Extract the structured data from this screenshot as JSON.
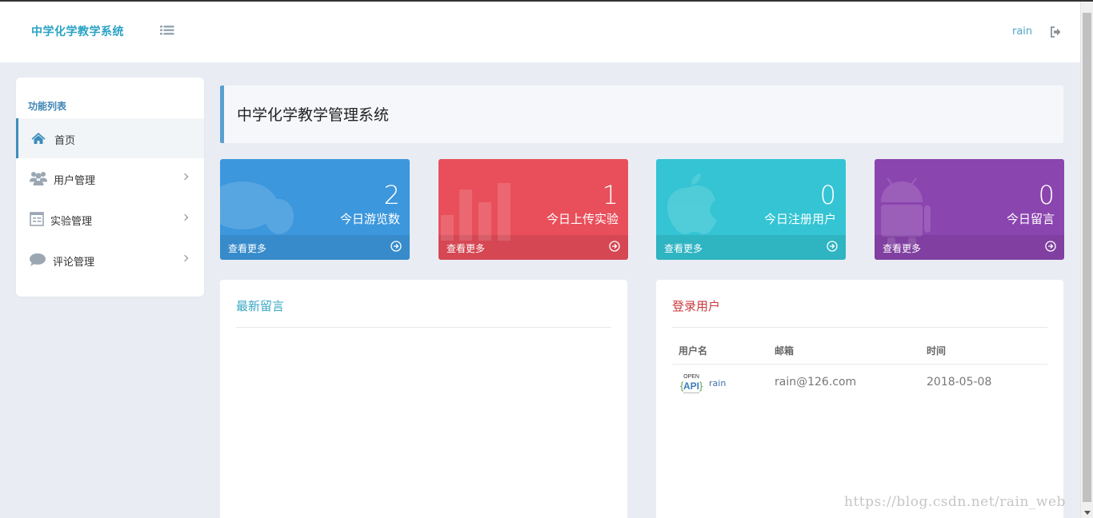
{
  "header": {
    "brand": "中学化学教学系统",
    "user_name": "rain"
  },
  "sidebar": {
    "title": "功能列表",
    "items": [
      {
        "label": "首页",
        "icon": "home-icon",
        "active": true
      },
      {
        "label": "用户管理",
        "icon": "users-icon"
      },
      {
        "label": "实验管理",
        "icon": "experiment-icon"
      },
      {
        "label": "评论管理",
        "icon": "comment-icon"
      }
    ]
  },
  "page": {
    "title": "中学化学教学管理系统"
  },
  "tiles": [
    {
      "number": "2",
      "caption": "今日游览数",
      "more": "查看更多",
      "color": "#3c97dd",
      "icon": "chat-icon"
    },
    {
      "number": "1",
      "caption": "今日上传实验",
      "more": "查看更多",
      "color": "#e84f5b",
      "icon": "bar-chart-icon"
    },
    {
      "number": "0",
      "caption": "今日注册用户",
      "more": "查看更多",
      "color": "#34c4d3",
      "icon": "apple-icon"
    },
    {
      "number": "0",
      "caption": "今日留言",
      "more": "查看更多",
      "color": "#8b45af",
      "icon": "android-icon"
    }
  ],
  "messages_panel": {
    "title": "最新留言",
    "title_color": "#3aa7c4"
  },
  "users_panel": {
    "title": "登录用户",
    "title_color": "#c9393d",
    "columns": [
      "用户名",
      "邮箱",
      "时间"
    ],
    "rows": [
      {
        "username": "rain",
        "email": "rain@126.com",
        "time": "2018-05-08"
      }
    ]
  },
  "watermark": "https://blog.csdn.net/rain_web"
}
